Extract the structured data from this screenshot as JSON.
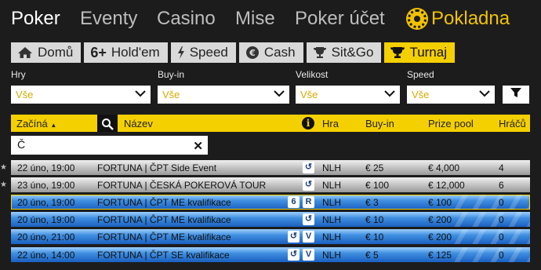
{
  "nav": {
    "items": [
      "Poker",
      "Eventy",
      "Casino",
      "Mise",
      "Poker účet"
    ],
    "cashier": "Pokladna"
  },
  "tabs": [
    {
      "label": "Domů",
      "icon": "home-icon"
    },
    {
      "label": "Hold'em",
      "icon": "six-plus-icon",
      "prefix": "6+"
    },
    {
      "label": "Speed",
      "icon": "lightning-icon"
    },
    {
      "label": "Cash",
      "icon": "euro-coin-icon"
    },
    {
      "label": "Sit&Go",
      "icon": "trophy-icon"
    },
    {
      "label": "Turnaj",
      "icon": "cup-icon"
    }
  ],
  "filters": {
    "hry": {
      "label": "Hry",
      "value": "Vše"
    },
    "buyin": {
      "label": "Buy-in",
      "value": "Vše"
    },
    "velikost": {
      "label": "Velikost",
      "value": "Vše"
    },
    "speed": {
      "label": "Speed",
      "value": "Vše"
    }
  },
  "table": {
    "headers": {
      "start": "Začíná",
      "name": "Název",
      "game": "Hra",
      "buyin": "Buy-in",
      "prize": "Prize pool",
      "players": "Hráčů"
    },
    "search_value": "Č",
    "rows": [
      {
        "start": "22 úno, 19:00",
        "name": "FORTUNA | ČPT Side Event",
        "badges": [
          "↺"
        ],
        "game": "NLH",
        "buyin": "€ 25",
        "prize": "€ 4,000",
        "players": "4",
        "style": "gray"
      },
      {
        "start": "23 úno, 19:00",
        "name": "FORTUNA | ČESKÁ POKEROVÁ TOUR",
        "badges": [
          "↺"
        ],
        "game": "NLH",
        "buyin": "€ 100",
        "prize": "€ 12,000",
        "players": "6",
        "style": "gray"
      },
      {
        "start": "20 úno, 19:00",
        "name": "FORTUNA | ČPT ME kvalifikace",
        "badges": [
          "6",
          "R"
        ],
        "game": "NLH",
        "buyin": "€ 3",
        "prize": "€ 100",
        "players": "0",
        "style": "blue"
      },
      {
        "start": "20 úno, 19:00",
        "name": "FORTUNA | ČPT ME kvalifikace",
        "badges": [
          "↺"
        ],
        "game": "NLH",
        "buyin": "€ 10",
        "prize": "€ 200",
        "players": "0",
        "style": "blue"
      },
      {
        "start": "20 úno, 21:00",
        "name": "FORTUNA | ČPT ME kvalifikace",
        "badges": [
          "↺",
          "V"
        ],
        "game": "NLH",
        "buyin": "€ 10",
        "prize": "€ 200",
        "players": "0",
        "style": "blue"
      },
      {
        "start": "22 úno, 14:00",
        "name": "FORTUNA | ČPT SE kvalifikace",
        "badges": [
          "↺",
          "V"
        ],
        "game": "NLH",
        "buyin": "€ 5",
        "prize": "€ 125",
        "players": "0",
        "style": "blue"
      }
    ]
  },
  "colors": {
    "accent": "#f5d000",
    "cashier": "#f2c200",
    "background": "#1c1c1c"
  }
}
